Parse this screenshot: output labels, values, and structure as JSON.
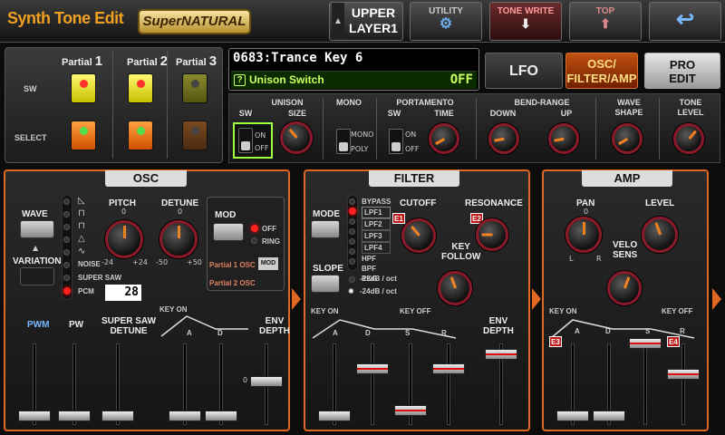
{
  "header": {
    "app_title": "Synth Tone Edit",
    "logo_text": "SuperNATURAL",
    "layer": {
      "line1": "UPPER",
      "line2": "LAYER1"
    },
    "utility_label": "UTILITY",
    "tone_write_label": "TONE WRITE",
    "top_label": "TOP"
  },
  "partials": {
    "labels": [
      "Partial",
      "Partial",
      "Partial"
    ],
    "numbers": [
      "1",
      "2",
      "3"
    ],
    "sw_label": "SW",
    "select_label": "SELECT"
  },
  "tone": {
    "name": "0683:Trance Key 6",
    "param_name": "Unison Switch",
    "param_value": "OFF",
    "help_icon": "?"
  },
  "tabs": {
    "lfo": "LFO",
    "osc_filter_amp": [
      "OSC/",
      "FILTER/AMP"
    ],
    "pro_edit": [
      "PRO",
      "EDIT"
    ]
  },
  "controls": {
    "unison": "UNISON",
    "sw": "SW",
    "size": "SIZE",
    "on": "ON",
    "off": "OFF",
    "mono": "MONO",
    "mono_opt": "MONO",
    "poly_opt": "POLY",
    "portamento": "PORTAMENTO",
    "time": "TIME",
    "bend_range": "BEND-RANGE",
    "down": "DOWN",
    "up": "UP",
    "wave_shape": [
      "WAVE",
      "SHAPE"
    ],
    "tone_level": [
      "TONE",
      "LEVEL"
    ]
  },
  "osc": {
    "title": "OSC",
    "wave": "WAVE",
    "variation": "VARIATION",
    "pitch": "PITCH",
    "detune": "DETUNE",
    "pitch_min": "-24",
    "pitch_max": "+24",
    "detune_min": "-50",
    "detune_max": "+50",
    "zero": "0",
    "noise": "NOISE",
    "super_saw": "SUPER SAW",
    "pcm": "PCM",
    "pcm_value": "28",
    "mod": "MOD",
    "mod_off": "OFF",
    "mod_ring": "RING",
    "partial1_osc": "Partial 1 OSC",
    "partial2_osc": "Partial 2 OSC",
    "mod_small": "MOD",
    "pwm": "PWM",
    "pw": "PW",
    "super_saw_detune": [
      "SUPER SAW",
      "DETUNE"
    ],
    "key_on": "KEY ON",
    "a": "A",
    "d": "D",
    "env_depth": [
      "ENV",
      "DEPTH"
    ]
  },
  "filter": {
    "title": "FILTER",
    "mode": "MODE",
    "slope": "SLOPE",
    "types": [
      "BYPASS",
      "LPF1",
      "LPF2",
      "LPF3",
      "LPF4",
      "HPF",
      "BPF",
      "PKG"
    ],
    "selected_type": "LPF1",
    "cutoff": "CUTOFF",
    "resonance": "RESONANCE",
    "key_follow": [
      "KEY",
      "FOLLOW"
    ],
    "e1": "E1",
    "e2": "E2",
    "slope12": "-12dB / oct",
    "slope24": "-24dB / oct",
    "key_on": "KEY ON",
    "key_off": "KEY OFF",
    "a": "A",
    "d": "D",
    "s": "S",
    "r": "R",
    "env_depth": [
      "ENV",
      "DEPTH"
    ]
  },
  "amp": {
    "title": "AMP",
    "pan": "PAN",
    "level": "LEVEL",
    "velo_sens": [
      "VELO",
      "SENS"
    ],
    "l": "L",
    "r": "R",
    "zero": "0",
    "e3": "E3",
    "e4": "E4",
    "key_on": "KEY ON",
    "key_off": "KEY OFF",
    "a": "A",
    "d": "D",
    "s": "S",
    "rr": "R"
  },
  "colors": {
    "accent": "#e06820",
    "knob_ring": "#8a1a2a",
    "lcd_text": "#cfff60",
    "title": "#f0a020"
  }
}
